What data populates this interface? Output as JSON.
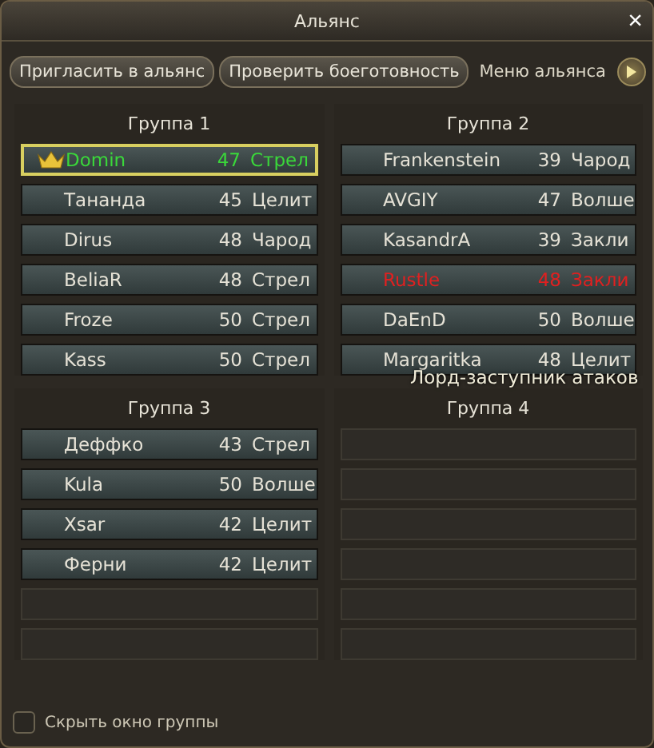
{
  "window": {
    "title": "Альянс",
    "close": "×"
  },
  "toolbar": {
    "buttons": [
      "Пригласить в альянс",
      "Проверить боеготовность"
    ],
    "menu_label": "Меню альянса"
  },
  "groups": [
    {
      "title": "Группа 1",
      "slots": [
        {
          "kind": "member",
          "name": "Domin",
          "level": "47",
          "class": "Стрел",
          "leader": true,
          "selected": true,
          "offline": false
        },
        {
          "kind": "member",
          "name": "Тананда",
          "level": "45",
          "class": "Целит",
          "leader": false,
          "selected": false,
          "offline": false
        },
        {
          "kind": "member",
          "name": "Dirus",
          "level": "48",
          "class": "Чарод",
          "leader": false,
          "selected": false,
          "offline": false
        },
        {
          "kind": "member",
          "name": "BeliaR",
          "level": "48",
          "class": "Стрел",
          "leader": false,
          "selected": false,
          "offline": false
        },
        {
          "kind": "member",
          "name": "Froze",
          "level": "50",
          "class": "Стрел",
          "leader": false,
          "selected": false,
          "offline": false
        },
        {
          "kind": "member",
          "name": "Kass",
          "level": "50",
          "class": "Стрел",
          "leader": false,
          "selected": false,
          "offline": false
        }
      ]
    },
    {
      "title": "Группа 2",
      "slots": [
        {
          "kind": "member",
          "name": "Frankenstein",
          "level": "39",
          "class": "Чарод",
          "leader": false,
          "selected": false,
          "offline": false
        },
        {
          "kind": "member",
          "name": "AVGIY",
          "level": "47",
          "class": "Волше",
          "leader": false,
          "selected": false,
          "offline": false
        },
        {
          "kind": "member",
          "name": "KasandrA",
          "level": "39",
          "class": "Закли",
          "leader": false,
          "selected": false,
          "offline": false
        },
        {
          "kind": "member",
          "name": "Rustle",
          "level": "48",
          "class": "Закли",
          "leader": false,
          "selected": false,
          "offline": true
        },
        {
          "kind": "member",
          "name": "DaEnD",
          "level": "50",
          "class": "Волше",
          "leader": false,
          "selected": false,
          "offline": false
        },
        {
          "kind": "member",
          "name": "Margaritka",
          "level": "48",
          "class": "Целит",
          "leader": false,
          "selected": false,
          "offline": false
        }
      ]
    },
    {
      "title": "Группа 3",
      "slots": [
        {
          "kind": "member",
          "name": "Деффко",
          "level": "43",
          "class": "Стрел",
          "leader": false,
          "selected": false,
          "offline": false
        },
        {
          "kind": "member",
          "name": "Kula",
          "level": "50",
          "class": "Волше",
          "leader": false,
          "selected": false,
          "offline": false
        },
        {
          "kind": "member",
          "name": "Xsar",
          "level": "42",
          "class": "Целит",
          "leader": false,
          "selected": false,
          "offline": false
        },
        {
          "kind": "member",
          "name": "Ферни",
          "level": "42",
          "class": "Целит",
          "leader": false,
          "selected": false,
          "offline": false
        },
        {
          "kind": "empty"
        },
        {
          "kind": "empty"
        }
      ]
    },
    {
      "title": "Группа 4",
      "slots": [
        {
          "kind": "empty"
        },
        {
          "kind": "empty"
        },
        {
          "kind": "empty"
        },
        {
          "kind": "empty"
        },
        {
          "kind": "empty"
        },
        {
          "kind": "empty"
        }
      ]
    }
  ],
  "overlay_text": "Лорд-заступник атаков",
  "hide_group_window": {
    "label": "Скрыть окно группы",
    "checked": false
  }
}
